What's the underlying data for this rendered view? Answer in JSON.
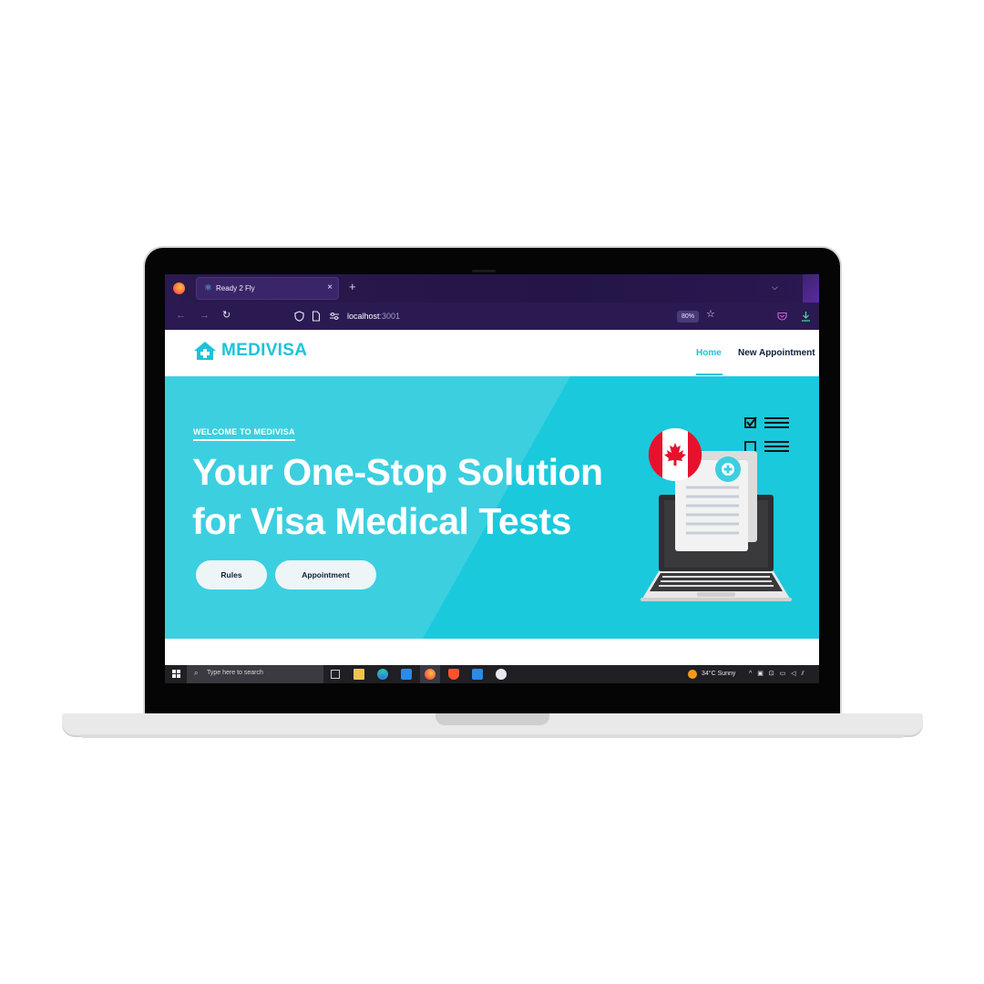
{
  "browser": {
    "tab_title": "Ready 2 Fly",
    "tab_close": "×",
    "new_tab": "+",
    "tab_list": "⌵",
    "back": "←",
    "forward": "→",
    "reload": "↻",
    "url_host": "localhost",
    "url_port": ":3001",
    "zoom": "80%",
    "star": "☆"
  },
  "site": {
    "brand": "MEDIVISA",
    "nav": {
      "home": "Home",
      "new_appointment": "New Appointment"
    },
    "hero": {
      "eyebrow": "WELCOME TO MEDIVISA",
      "title_line1": "Your One-Stop Solution",
      "title_line2": "for Visa Medical Tests",
      "button_rules": "Rules",
      "button_appointment": "Appointment"
    }
  },
  "taskbar": {
    "search_placeholder": "Type here to search",
    "weather": "34°C  Sunny"
  },
  "colors": {
    "brand_accent": "#1cc3da",
    "hero_bg": "#1bc9dd",
    "browser_bg": "#2b1a52",
    "nav_dark": "#0b1d3b"
  },
  "icons": [
    "firefox-icon",
    "react-icon",
    "shield-icon",
    "page-icon",
    "permissions-icon",
    "home-plus-icon",
    "windows-start-icon",
    "search-icon",
    "file-explorer-icon",
    "edge-icon",
    "vscode-icon",
    "brave-icon",
    "weather-sun-icon",
    "canada-flag-icon",
    "laptop-illustration"
  ]
}
